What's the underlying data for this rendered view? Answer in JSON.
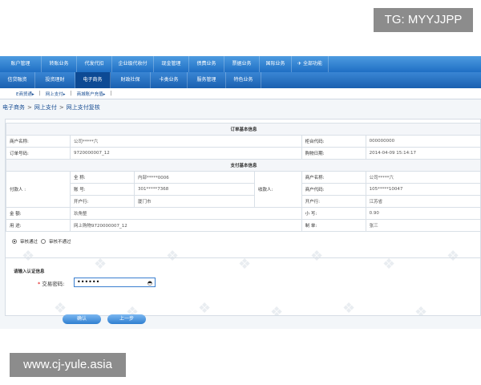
{
  "watermarks": {
    "top": "TG: MYYJJPP",
    "bottom": "www.cj-yule.asia"
  },
  "nav_primary": [
    "账户管理",
    "转账业务",
    "代发代扣",
    "企业级代收付",
    "现金管理",
    "债费业务",
    "票据业务",
    "国际业务",
    "✈ 全部功能"
  ],
  "nav_secondary": [
    "信贷融资",
    "投资理财",
    "电子商务",
    "财政社保",
    "卡类业务",
    "服务管理",
    "特色业务"
  ],
  "nav_secondary_active": "电子商务",
  "sub_nav": [
    "E商贸通▸",
    "网上支付▸",
    "商城账户充值▸"
  ],
  "breadcrumb": [
    "电子商务",
    "网上支付",
    "网上支付复核"
  ],
  "order_section": {
    "title": "订单基本信息",
    "merchant_name_label": "商户名称:",
    "merchant_name": "公司*****六",
    "counter_code_label": "柜台代码:",
    "counter_code": "000000000",
    "order_no_label": "订单号码:",
    "order_no": "9720000007_12",
    "purchase_date_label": "购物日期:",
    "purchase_date": "2014-04-09 15:14:17"
  },
  "payment_section": {
    "title": "支付基本信息",
    "payer_label": "付款人 :",
    "payee_label": "收款人:",
    "full_name_label": "全  称:",
    "full_name": "内部*****0006",
    "account_label": "账  号:",
    "account": "301*****7368",
    "bank_label": "开户行:",
    "bank": "厦门市",
    "payee_merchant_label": "商户名称:",
    "payee_merchant": "公司*****六",
    "payee_code_label": "商户代码:",
    "payee_code": "105*****10047",
    "payee_bank_label": "开户行:",
    "payee_bank": "江苏省",
    "amount_label": "金   额:",
    "amount_words": "玖角整",
    "amount_small_label": "小   写:",
    "amount_small": "0.90",
    "purpose_label": "用   途:",
    "purpose": "网上购物9720000007_12",
    "maker_label": "制   单:",
    "maker": "张三"
  },
  "review": {
    "approve": "审核通过",
    "reject": "审核不通过",
    "selected": "approve"
  },
  "auth": {
    "title": "请输入认证信息",
    "password_label": "交易密码:",
    "password_value": "••••••"
  },
  "buttons": {
    "confirm": "确认",
    "back": "上一步"
  }
}
